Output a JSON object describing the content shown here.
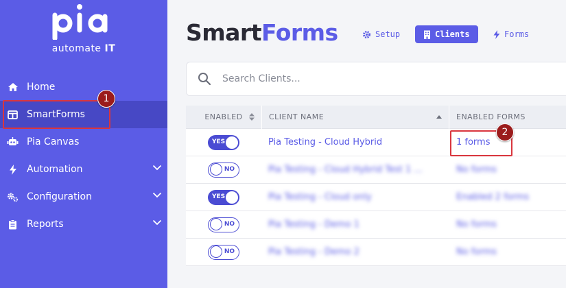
{
  "sidebar": {
    "logo": "pia",
    "tagline_main": "automate",
    "tagline_bold": "IT",
    "items": [
      {
        "label": "Home",
        "icon": "home-icon"
      },
      {
        "label": "SmartForms",
        "icon": "columns-icon",
        "active": true
      },
      {
        "label": "Pia Canvas",
        "icon": "robot-icon"
      },
      {
        "label": "Automation",
        "icon": "bolt-icon",
        "expandable": true
      },
      {
        "label": "Configuration",
        "icon": "cogs-icon",
        "expandable": true
      },
      {
        "label": "Reports",
        "icon": "clipboard-icon",
        "expandable": true
      }
    ]
  },
  "header": {
    "title_dark": "Smart",
    "title_accent": "Forms",
    "tabs": [
      {
        "label": "Setup",
        "icon": "gear-icon"
      },
      {
        "label": "Clients",
        "icon": "building-icon",
        "active": true
      },
      {
        "label": "Forms",
        "icon": "bolt-icon"
      }
    ]
  },
  "search": {
    "placeholder": "Search Clients..."
  },
  "table": {
    "columns": [
      "ENABLED",
      "CLIENT NAME",
      "ENABLED FORMS"
    ],
    "rows": [
      {
        "enabled": true,
        "toggle_label": "YES",
        "client": "Pia Testing - Cloud Hybrid",
        "forms": "1 forms",
        "blurred": false
      },
      {
        "enabled": false,
        "toggle_label": "NO",
        "client": "Pia Testing - Cloud Hybrid Test 1 ...",
        "forms": "No forms",
        "blurred": true
      },
      {
        "enabled": true,
        "toggle_label": "YES",
        "client": "Pia Testing - Cloud only",
        "forms": "Enabled 2 forms",
        "blurred": true
      },
      {
        "enabled": false,
        "toggle_label": "NO",
        "client": "Pia Testing - Demo 1",
        "forms": "No forms",
        "blurred": true
      },
      {
        "enabled": false,
        "toggle_label": "NO",
        "client": "Pia Testing - Demo 2",
        "forms": "No forms",
        "blurred": true
      }
    ]
  },
  "annotations": [
    "1",
    "2"
  ],
  "colors": {
    "brand": "#5b5ce6",
    "sidebar_active": "#4748c5",
    "highlight": "#d9363e",
    "badge": "#9b1c1c"
  }
}
